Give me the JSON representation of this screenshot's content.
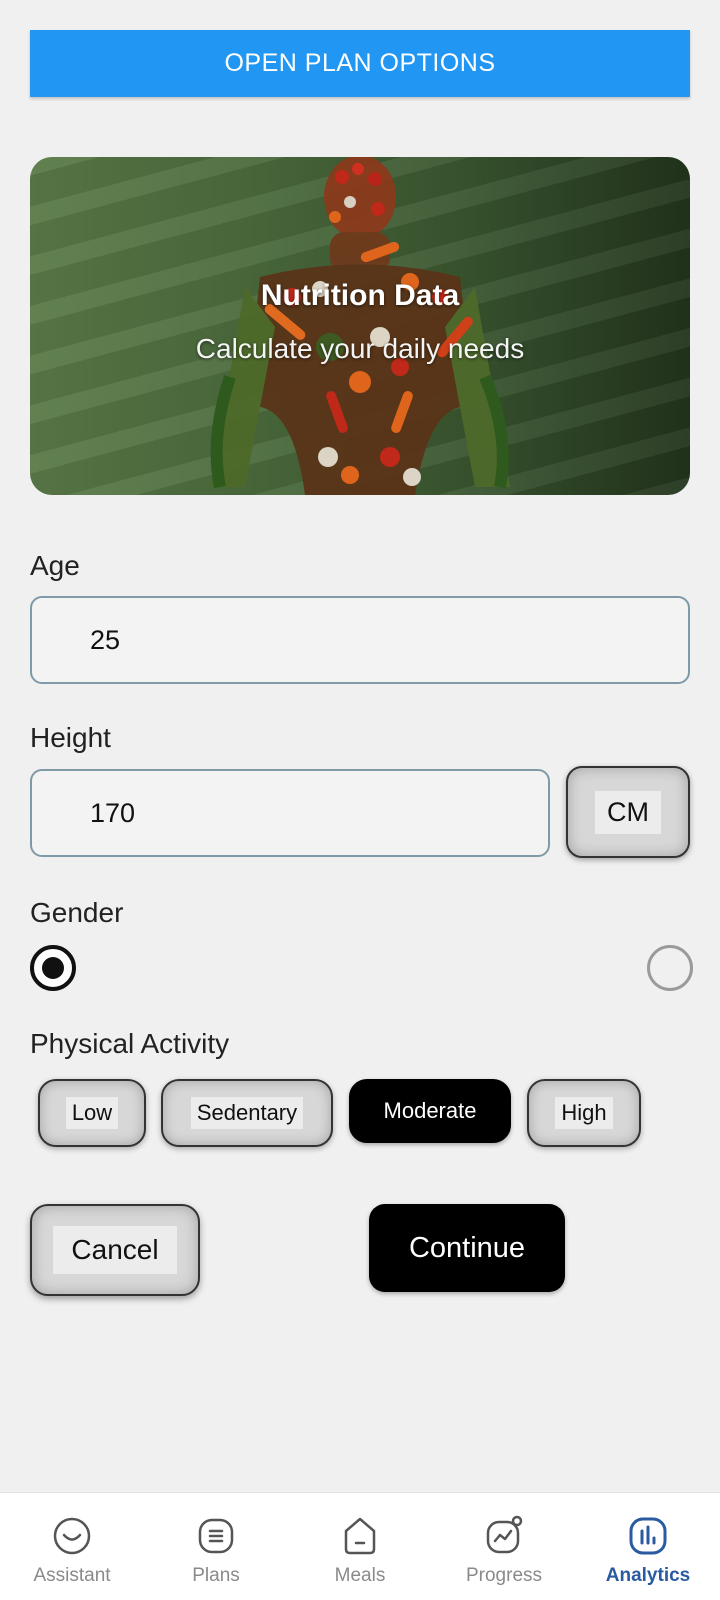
{
  "top_button": {
    "label": "OPEN PLAN OPTIONS"
  },
  "hero": {
    "title": "Nutrition Data",
    "subtitle": "Calculate your daily needs"
  },
  "form": {
    "age": {
      "label": "Age",
      "value": "25"
    },
    "height": {
      "label": "Height",
      "value": "170",
      "unit": "CM"
    },
    "gender": {
      "label": "Gender",
      "selected_index": 0
    },
    "activity": {
      "label": "Physical Activity",
      "options": [
        "Low",
        "Sedentary",
        "Moderate",
        "High"
      ],
      "selected": "Moderate"
    }
  },
  "actions": {
    "cancel": "Cancel",
    "continue": "Continue"
  },
  "nav": {
    "items": [
      {
        "label": "Assistant",
        "icon": "assistant-icon"
      },
      {
        "label": "Plans",
        "icon": "plans-icon"
      },
      {
        "label": "Meals",
        "icon": "meals-icon"
      },
      {
        "label": "Progress",
        "icon": "progress-icon"
      },
      {
        "label": "Analytics",
        "icon": "analytics-icon"
      }
    ],
    "active": "Analytics"
  },
  "colors": {
    "primary_button": "#2196f3",
    "active_nav": "#2a5aa0",
    "selected_chip": "#000000"
  }
}
